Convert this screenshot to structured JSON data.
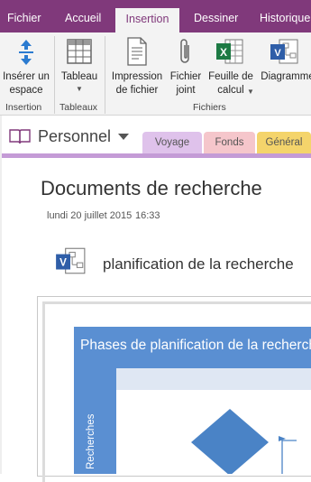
{
  "tabs": [
    "Fichier",
    "Accueil",
    "Insertion",
    "Dessiner",
    "Historique"
  ],
  "active_tab": "Insertion",
  "ribbon": {
    "insert_space": {
      "line1": "Insérer un",
      "line2": "espace"
    },
    "table": {
      "label": "Tableau"
    },
    "file_printout": {
      "line1": "Impression",
      "line2": "de fichier"
    },
    "attachment": {
      "line1": "Fichier",
      "line2": "joint"
    },
    "spreadsheet": {
      "line1": "Feuille de",
      "line2": "calcul"
    },
    "diagram": {
      "label": "Diagramme"
    },
    "groups": {
      "insertion": "Insertion",
      "tables": "Tableaux",
      "files": "Fichiers"
    }
  },
  "notebook": {
    "name": "Personnel",
    "sections": [
      "Voyage",
      "Fonds",
      "Général"
    ]
  },
  "page": {
    "title": "Documents de recherche",
    "date": "lundi 20 juillet 2015",
    "time": "16:33",
    "file_name": "planification de la recherche",
    "diagram_title": "Phases de planification de la recherche",
    "lane_label": "Recherches"
  },
  "colors": {
    "brand": "#80397b",
    "section_voyage": "#dfc2eb",
    "section_fonds": "#f5c6cb",
    "section_general": "#f4d46b",
    "diagram_blue": "#5a8fd2"
  }
}
